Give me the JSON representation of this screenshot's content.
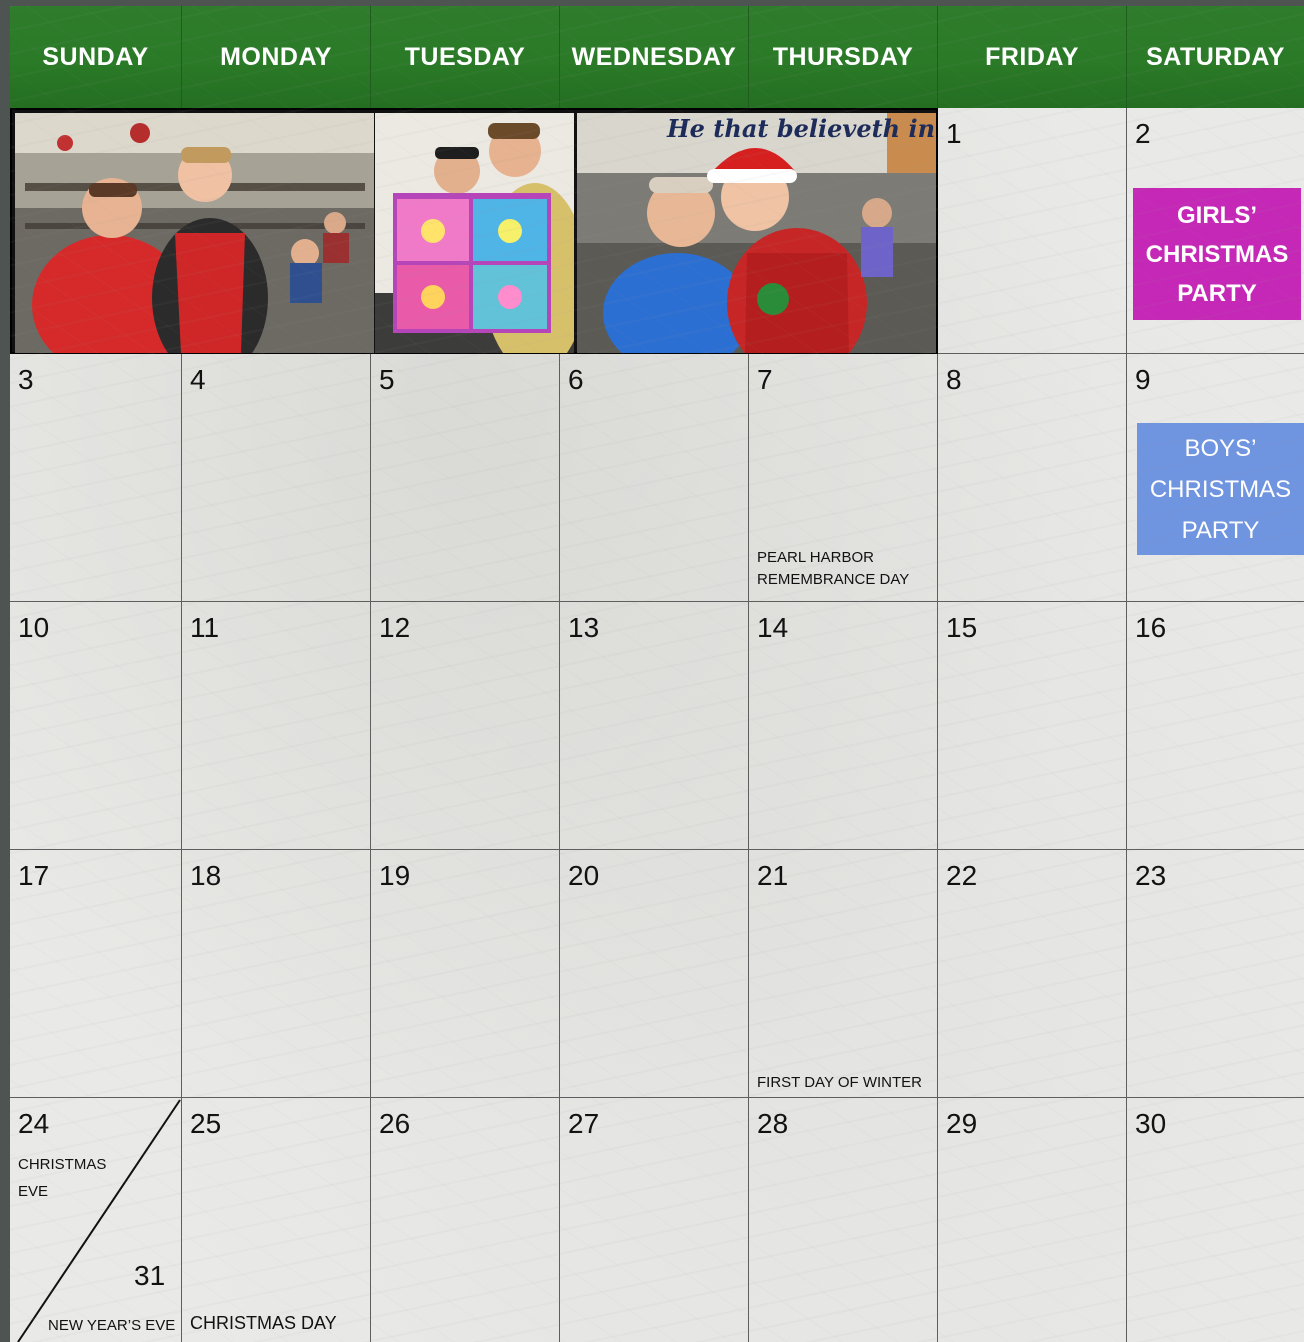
{
  "weekdays": [
    "SUNDAY",
    "MONDAY",
    "TUESDAY",
    "WEDNESDAY",
    "THURSDAY",
    "FRIDAY",
    "SATURDAY"
  ],
  "days": {
    "d1": "1",
    "d2": "2",
    "d3": "3",
    "d4": "4",
    "d5": "5",
    "d6": "6",
    "d7": "7",
    "d8": "8",
    "d9": "9",
    "d10": "10",
    "d11": "11",
    "d12": "12",
    "d13": "13",
    "d14": "14",
    "d15": "15",
    "d16": "16",
    "d17": "17",
    "d18": "18",
    "d19": "19",
    "d20": "20",
    "d21": "21",
    "d22": "22",
    "d23": "23",
    "d24": "24",
    "d25": "25",
    "d26": "26",
    "d27": "27",
    "d28": "28",
    "d29": "29",
    "d30": "30",
    "d31": "31"
  },
  "notes": {
    "pearl_harbor_1": "PEARL HARBOR",
    "pearl_harbor_2": "REMEMBRANCE DAY",
    "first_day_winter": "FIRST DAY OF WINTER",
    "christmas_eve_1": "CHRISTMAS",
    "christmas_eve_2": "EVE",
    "new_years_eve": "NEW YEAR’S EVE",
    "christmas_day": "CHRISTMAS DAY"
  },
  "events": {
    "girls": [
      "GIRLS’",
      "CHRISTMAS",
      "PARTY"
    ],
    "boys": [
      "BOYS’",
      "CHRISTMAS",
      "PARTY"
    ]
  },
  "photos": {
    "photo3_sign": "He that believeth in"
  },
  "colors": {
    "header_green": "#2a7a27",
    "girls_party": "#c528b6",
    "boys_party": "#6f94e0"
  }
}
